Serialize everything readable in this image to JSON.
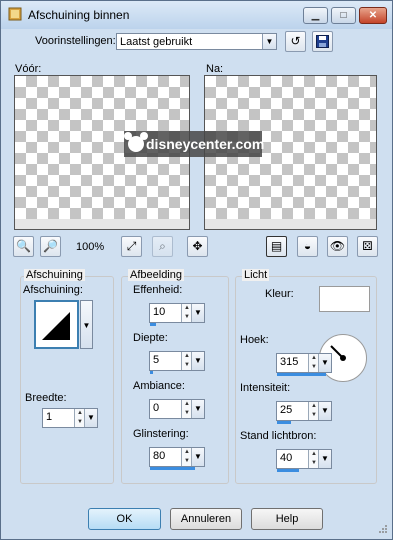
{
  "window": {
    "title": "Afschuining binnen",
    "controls": {
      "minimize": "▁",
      "maximize": "□",
      "close": "✕"
    }
  },
  "presets": {
    "label": "Voorinstellingen:",
    "value": "Laatst gebruikt"
  },
  "preview": {
    "before_label": "Vóór:",
    "after_label": "Na:",
    "watermark": "disneycenter.com",
    "zoom": "100%"
  },
  "bevel": {
    "group_title": "Afschuining",
    "shape_label": "Afschuining:",
    "width_label": "Breedte:",
    "width_value": "1"
  },
  "image": {
    "group_title": "Afbeelding",
    "fields": [
      {
        "label": "Effenheid:",
        "value": "10",
        "level": 0.1
      },
      {
        "label": "Diepte:",
        "value": "5",
        "level": 0.05
      },
      {
        "label": "Ambiance:",
        "value": "0",
        "level": 0.0
      },
      {
        "label": "Glinstering:",
        "value": "80",
        "level": 0.8
      }
    ]
  },
  "light": {
    "group_title": "Licht",
    "color_label": "Kleur:",
    "color_value": "#ffffff",
    "fields": [
      {
        "label": "Hoek:",
        "value": "315",
        "level": 0.875
      },
      {
        "label": "Intensiteit:",
        "value": "25",
        "level": 0.25
      },
      {
        "label": "Stand lichtbron:",
        "value": "40",
        "level": 0.4
      }
    ]
  },
  "buttons": {
    "ok": "OK",
    "cancel": "Annuleren",
    "help": "Help"
  },
  "colors": {
    "accent": "#3b8de0",
    "title_bar": "#cfdff0"
  }
}
